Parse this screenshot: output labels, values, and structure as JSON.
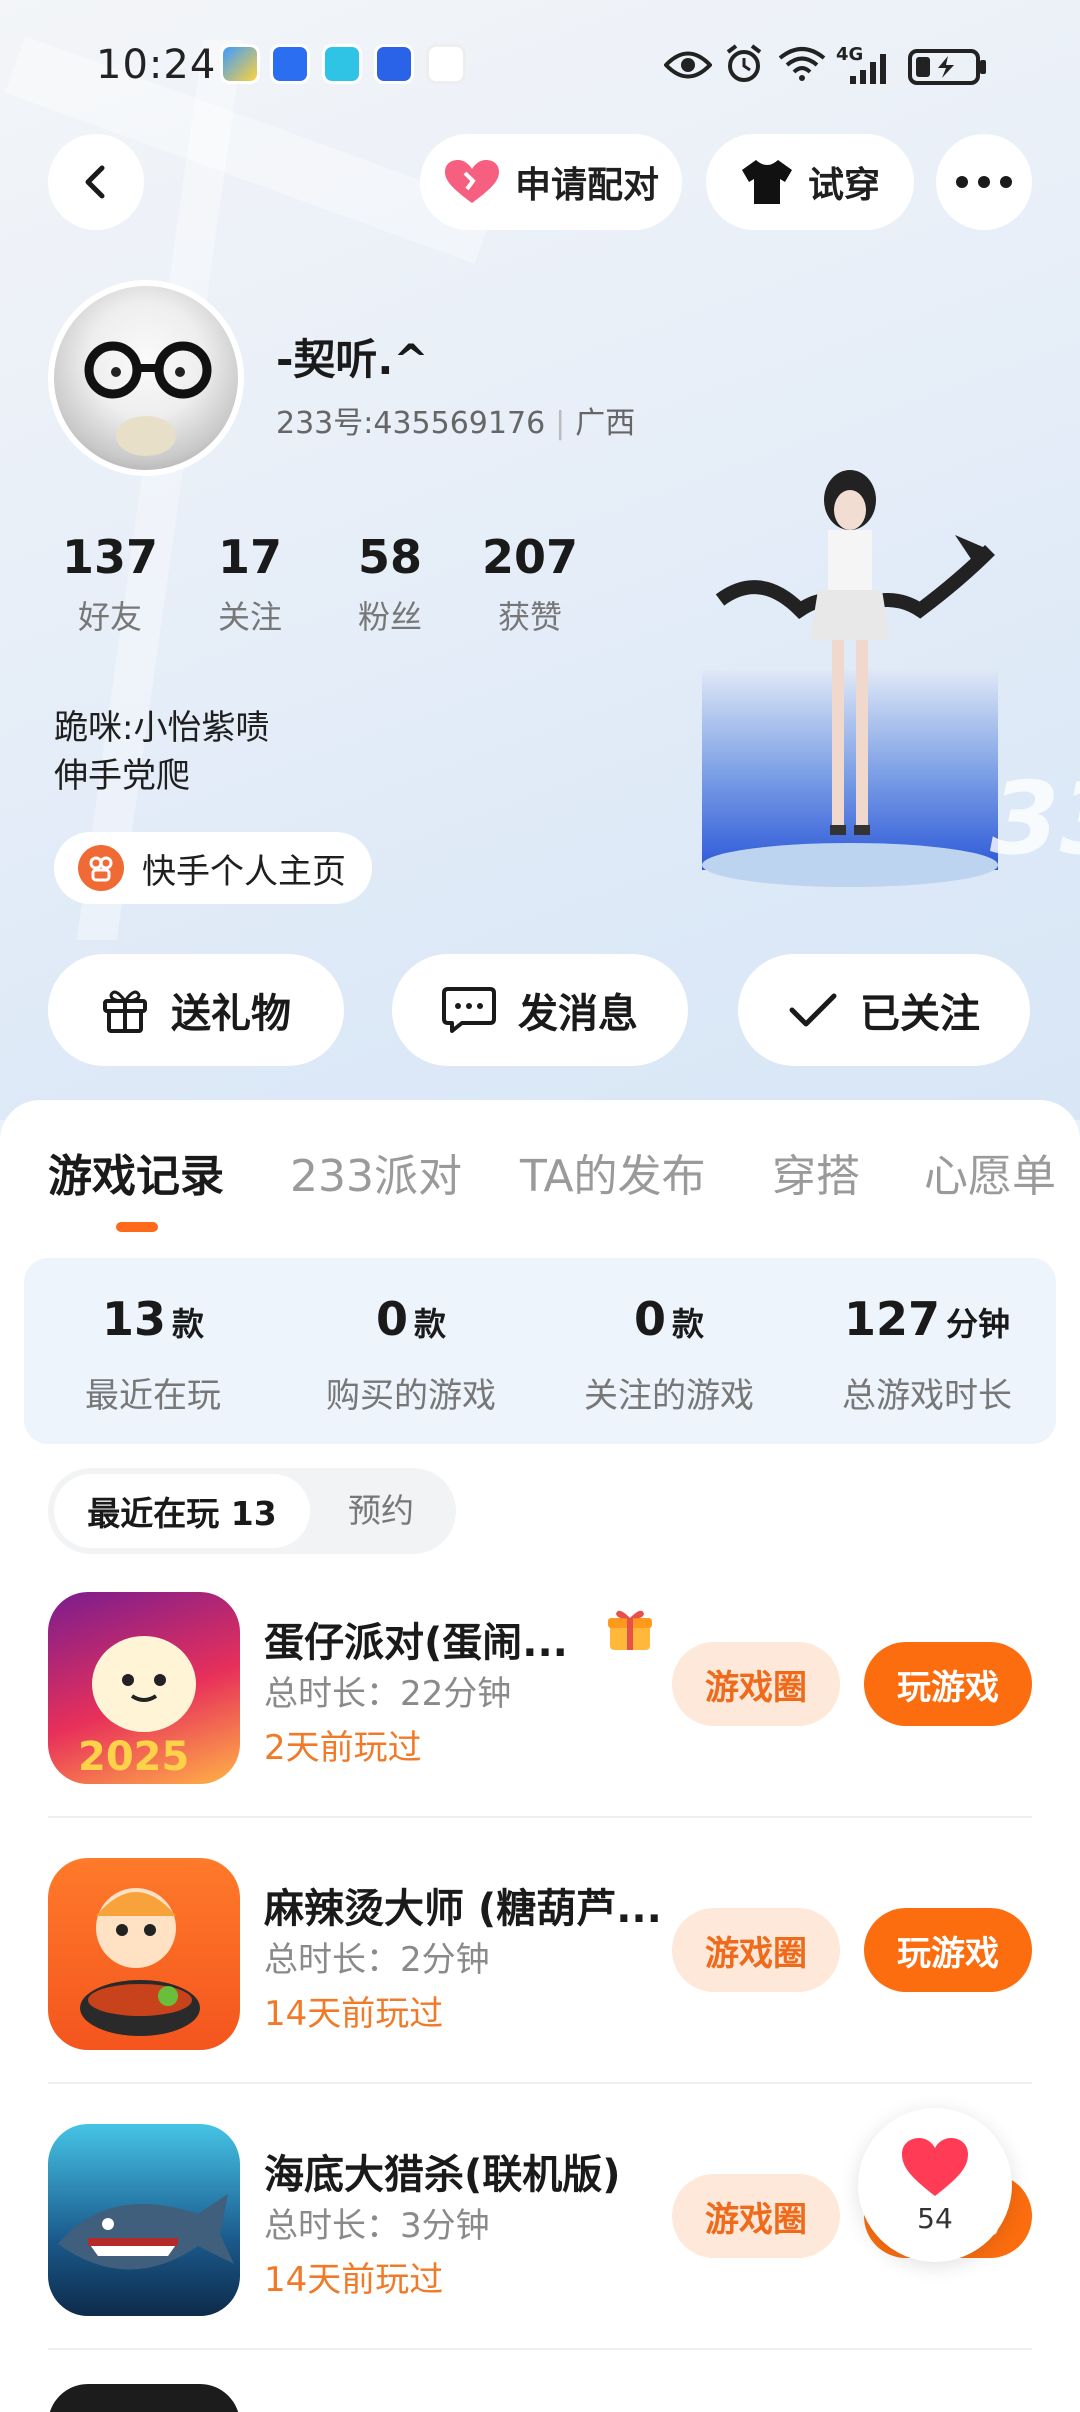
{
  "status_bar": {
    "time": "10:24",
    "network": "4G"
  },
  "header": {
    "pair_label": "申请配对",
    "tryon_label": "试穿"
  },
  "profile": {
    "name": "-契听.^",
    "uid": "233号:435569176",
    "region": "广西",
    "stats": [
      {
        "value": "137",
        "label": "好友"
      },
      {
        "value": "17",
        "label": "关注"
      },
      {
        "value": "58",
        "label": "粉丝"
      },
      {
        "value": "207",
        "label": "获赞"
      }
    ],
    "bio_line1": "跪咪:小怡紫啧",
    "bio_line2": "伸手党爬",
    "kuaishou_label": "快手个人主页"
  },
  "actions": {
    "gift": "送礼物",
    "message": "发消息",
    "follow": "已关注"
  },
  "tabs": [
    "游戏记录",
    "233派对",
    "TA的发布",
    "穿搭",
    "心愿单"
  ],
  "summary": [
    {
      "value": "13",
      "unit": "款",
      "label": "最近在玩"
    },
    {
      "value": "0",
      "unit": "款",
      "label": "购买的游戏"
    },
    {
      "value": "0",
      "unit": "款",
      "label": "关注的游戏"
    },
    {
      "value": "127",
      "unit": "分钟",
      "label": "总游戏时长"
    }
  ],
  "segment": {
    "recent": "最近在玩 13",
    "reserve": "预约"
  },
  "games": [
    {
      "name": "蛋仔派对(蛋闹...",
      "duration": "总时长：22分钟",
      "last_played": "2天前玩过",
      "circle": "游戏圈",
      "play": "玩游戏"
    },
    {
      "name": "麻辣烫大师 (糖葫芦...",
      "duration": "总时长：2分钟",
      "last_played": "14天前玩过",
      "circle": "游戏圈",
      "play": "玩游戏"
    },
    {
      "name": "海底大猎杀(联机版)",
      "duration": "总时长：3分钟",
      "last_played": "14天前玩过",
      "circle": "游戏圈",
      "play": "玩游戏"
    }
  ],
  "like": {
    "count": "54"
  },
  "colors": {
    "accent": "#fb6d0f",
    "accent_light": "#fde8da",
    "played_text": "#f07a28"
  }
}
